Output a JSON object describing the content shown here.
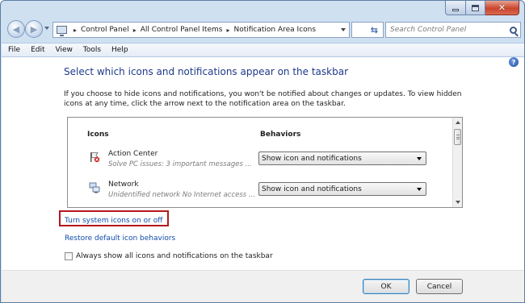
{
  "window": {
    "caption": {
      "minimize_icon": "minimize-icon",
      "maximize_icon": "maximize-icon",
      "close_icon": "close-icon"
    }
  },
  "address_bar": {
    "breadcrumbs": [
      "Control Panel",
      "All Control Panel Items",
      "Notification Area Icons"
    ],
    "separator": "▸",
    "refresh_glyph": "⇆",
    "search_placeholder": "Search Control Panel"
  },
  "menu": [
    "File",
    "Edit",
    "View",
    "Tools",
    "Help"
  ],
  "content": {
    "help_glyph": "?",
    "heading": "Select which icons and notifications appear on the taskbar",
    "description": "If you choose to hide icons and notifications, you won't be notified about changes or updates. To view hidden icons at any time, click the arrow next to the notification area on the taskbar.",
    "table": {
      "col_icons": "Icons",
      "col_behaviors": "Behaviors",
      "rows": [
        {
          "name": "Action Center",
          "detail": "Solve PC issues: 3 important messages  ...",
          "behavior": "Show icon and notifications",
          "icon": "action-center-flag-icon"
        },
        {
          "name": "Network",
          "detail": "Unidentified network No Internet access ...",
          "behavior": "Show icon and notifications",
          "icon": "network-icon"
        }
      ]
    },
    "links": {
      "system_icons": "Turn system icons on or off",
      "restore": "Restore default icon behaviors"
    },
    "checkbox": {
      "label": "Always show all icons and notifications on the taskbar",
      "checked": false
    }
  },
  "footer": {
    "ok": "OK",
    "cancel": "Cancel"
  },
  "colors": {
    "heading": "#1e3a8a",
    "link": "#0f4bab",
    "highlight_border": "#b5171d"
  }
}
